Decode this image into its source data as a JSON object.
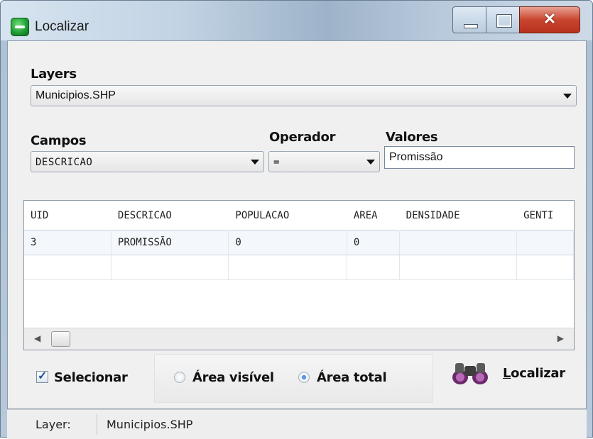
{
  "window": {
    "title": "Localizar"
  },
  "layers": {
    "label": "Layers",
    "selected": "Municipios.SHP"
  },
  "campos": {
    "label": "Campos",
    "selected": "DESCRICAO"
  },
  "operador": {
    "label": "Operador",
    "selected": "="
  },
  "valores": {
    "label": "Valores",
    "value": "Promissão"
  },
  "grid": {
    "columns": [
      "UID",
      "DESCRICAO",
      "POPULACAO",
      "AREA",
      "DENSIDADE",
      "GENTI"
    ],
    "rows": [
      [
        "3",
        "PROMISSÃO",
        "0",
        "0",
        "",
        ""
      ],
      [
        "",
        "",
        "",
        "",
        "",
        ""
      ]
    ]
  },
  "options": {
    "selecionar_label": "Selecionar",
    "selecionar_checked": true,
    "area_visivel_label": "Área visível",
    "area_total_label": "Área total",
    "selected_area": "Área total"
  },
  "localizar_button": {
    "underlined": "L",
    "rest": "ocalizar"
  },
  "status": {
    "label": "Layer:",
    "value": "Municipios.SHP"
  },
  "icons": {
    "app": "app-icon",
    "binoculars": "binoculars-icon"
  }
}
